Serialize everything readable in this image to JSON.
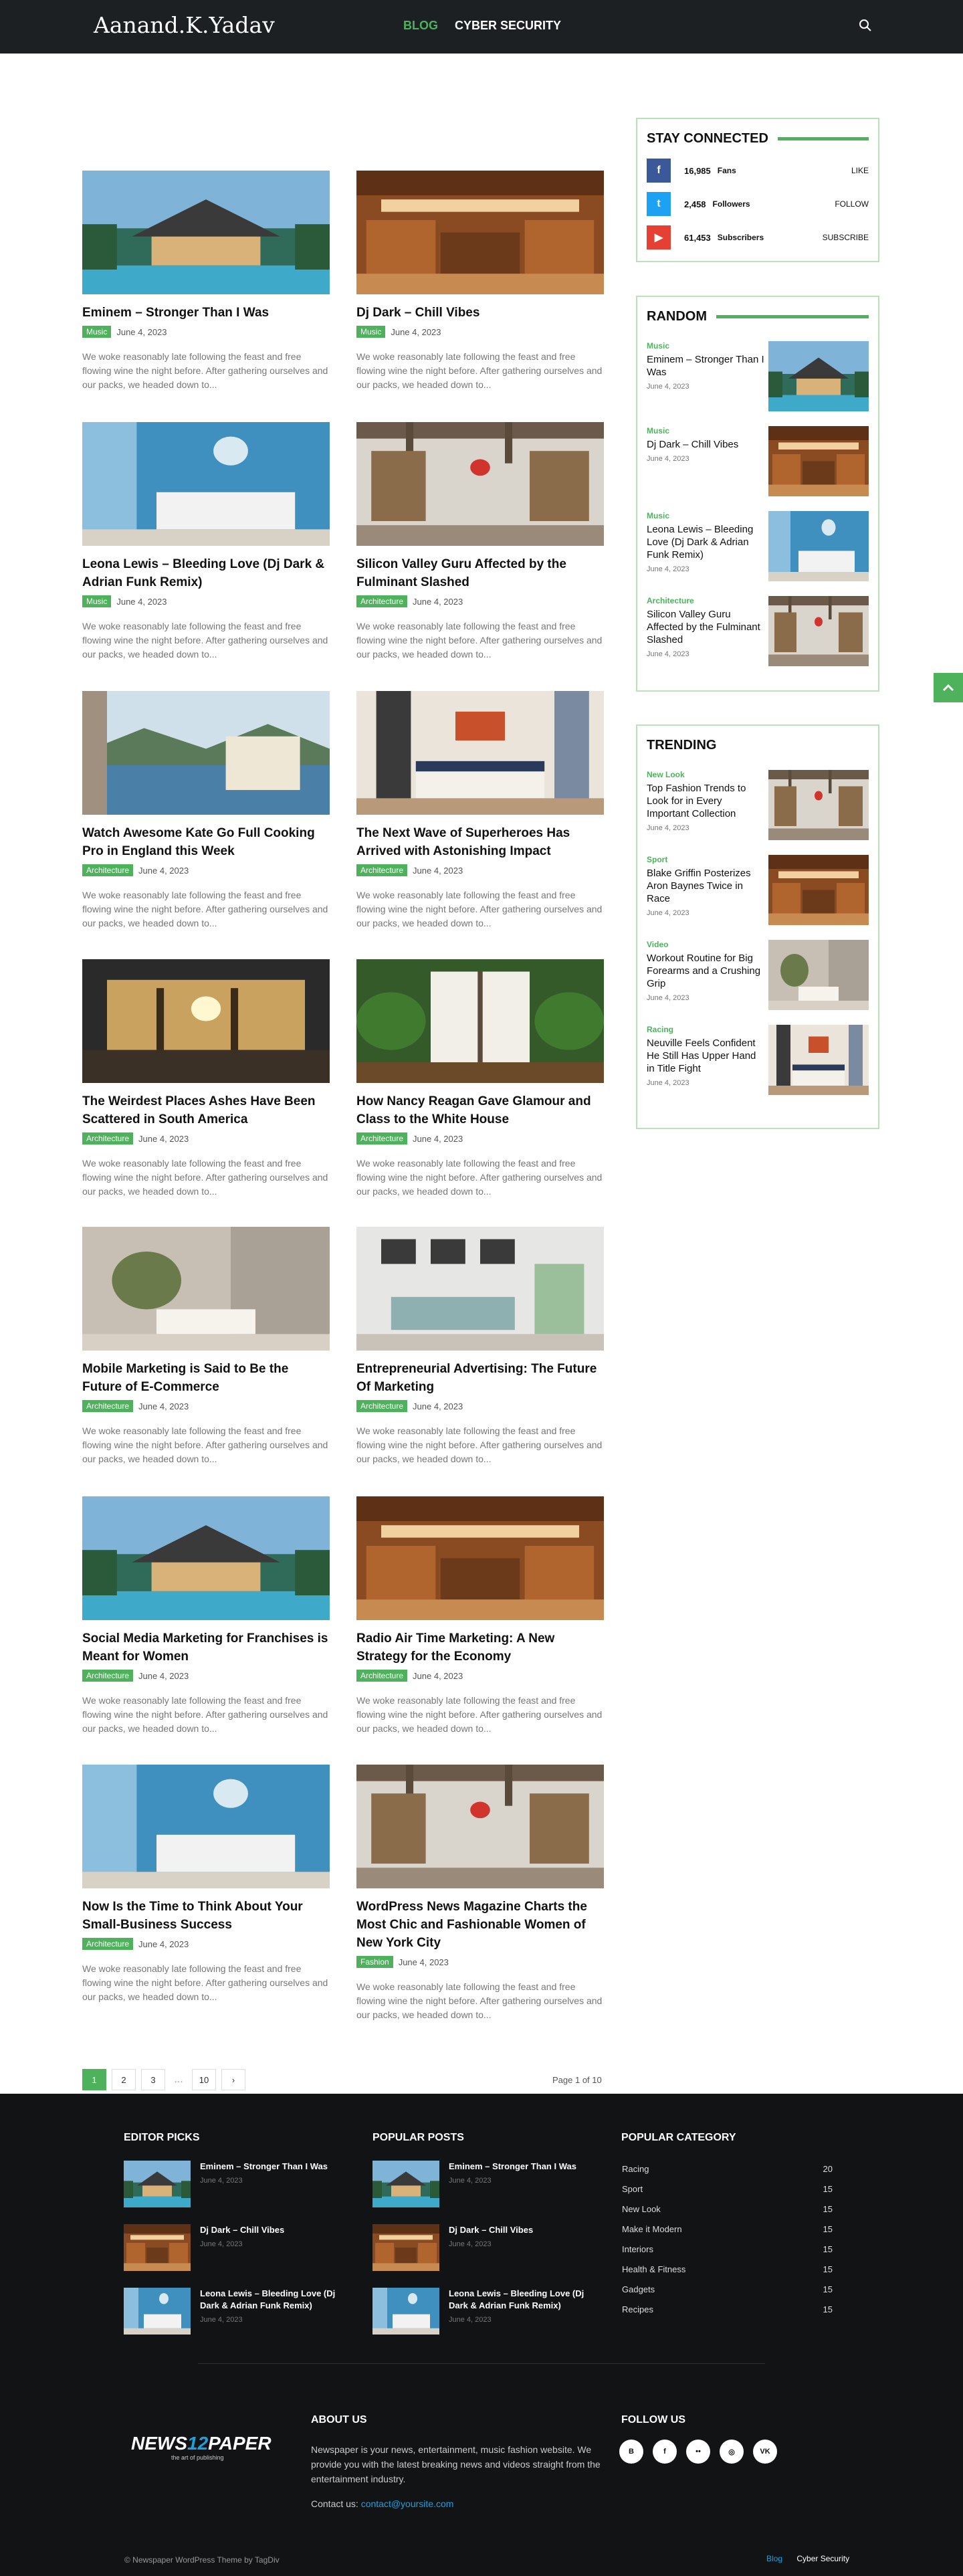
{
  "header": {
    "logo": "Aanand.K.Yadav",
    "nav": [
      "BLOG",
      "CYBER SECURITY"
    ],
    "search_icon": "search-icon"
  },
  "posts": [
    {
      "title": "Eminem – Stronger Than I Was",
      "category": "Music",
      "date": "June 4, 2023",
      "excerpt": "We woke reasonably late following the feast and free flowing wine the night before. After gathering ourselves and our packs, we headed down to...",
      "scene": "pool"
    },
    {
      "title": "Dj Dark – Chill Vibes",
      "category": "Music",
      "date": "June 4, 2023",
      "excerpt": "We woke reasonably late following the feast and free flowing wine the night before. After gathering ourselves and our packs, we headed down to...",
      "scene": "wood"
    },
    {
      "title": "Leona Lewis – Bleeding Love (Dj Dark & Adrian Funk Remix)",
      "category": "Music",
      "date": "June 4, 2023",
      "excerpt": "We woke reasonably late following the feast and free flowing wine the night before. After gathering ourselves and our packs, we headed down to...",
      "scene": "blue"
    },
    {
      "title": "Silicon Valley Guru Affected by the Fulminant Slashed",
      "category": "Architecture",
      "date": "June 4, 2023",
      "excerpt": "We woke reasonably late following the feast and free flowing wine the night before. After gathering ourselves and our packs, we headed down to...",
      "scene": "loft"
    },
    {
      "title": "Watch Awesome Kate Go Full Cooking Pro in England this Week",
      "category": "Architecture",
      "date": "June 4, 2023",
      "excerpt": "We woke reasonably late following the feast and free flowing wine the night before. After gathering ourselves and our packs, we headed down to...",
      "scene": "lake"
    },
    {
      "title": "The Next Wave of Superheroes Has Arrived with Astonishing Impact",
      "category": "Architecture",
      "date": "June 4, 2023",
      "excerpt": "We woke reasonably late following the feast and free flowing wine the night before. After gathering ourselves and our packs, we headed down to...",
      "scene": "bedroom"
    },
    {
      "title": "The Weirdest Places Ashes Have Been Scattered in South America",
      "category": "Architecture",
      "date": "June 4, 2023",
      "excerpt": "We woke reasonably late following the feast and free flowing wine the night before. After gathering ourselves and our packs, we headed down to...",
      "scene": "veranda"
    },
    {
      "title": "How Nancy Reagan Gave Glamour and Class to the White House",
      "category": "Architecture",
      "date": "June 4, 2023",
      "excerpt": "We woke reasonably late following the feast and free flowing wine the night before. After gathering ourselves and our packs, we headed down to...",
      "scene": "plants"
    },
    {
      "title": "Mobile Marketing is Said to Be the Future of E-Commerce",
      "category": "Architecture",
      "date": "June 4, 2023",
      "excerpt": "We woke reasonably late following the feast and free flowing wine the night before. After gathering ourselves and our packs, we headed down to...",
      "scene": "bath"
    },
    {
      "title": "Entrepreneurial Advertising: The Future Of Marketing",
      "category": "Architecture",
      "date": "June 4, 2023",
      "excerpt": "We woke reasonably late following the feast and free flowing wine the night before. After gathering ourselves and our packs, we headed down to...",
      "scene": "gallery"
    },
    {
      "title": "Social Media Marketing for Franchises is Meant for Women",
      "category": "Architecture",
      "date": "June 4, 2023",
      "excerpt": "We woke reasonably late following the feast and free flowing wine the night before. After gathering ourselves and our packs, we headed down to...",
      "scene": "pool"
    },
    {
      "title": "Radio Air Time Marketing: A New Strategy for the Economy",
      "category": "Architecture",
      "date": "June 4, 2023",
      "excerpt": "We woke reasonably late following the feast and free flowing wine the night before. After gathering ourselves and our packs, we headed down to...",
      "scene": "wood"
    },
    {
      "title": "Now Is the Time to Think About Your Small-Business Success",
      "category": "Architecture",
      "date": "June 4, 2023",
      "excerpt": "We woke reasonably late following the feast and free flowing wine the night before. After gathering ourselves and our packs, we headed down to...",
      "scene": "blue"
    },
    {
      "title": "WordPress News Magazine Charts the Most Chic and Fashionable Women of New York City",
      "category": "Fashion",
      "date": "June 4, 2023",
      "excerpt": "We woke reasonably late following the feast and free flowing wine the night before. After gathering ourselves and our packs, we headed down to...",
      "scene": "loft"
    }
  ],
  "stay_connected": {
    "title": "STAY CONNECTED",
    "rows": [
      {
        "icon": "f",
        "count": "16,985",
        "name": "Fans",
        "action": "LIKE",
        "color": "#3b5998"
      },
      {
        "icon": "t",
        "count": "2,458",
        "name": "Followers",
        "action": "FOLLOW",
        "color": "#1da1f2"
      },
      {
        "icon": "▶",
        "count": "61,453",
        "name": "Subscribers",
        "action": "SUBSCRIBE",
        "color": "#e44134"
      }
    ]
  },
  "random": {
    "title": "RANDOM",
    "items": [
      {
        "category": "Music",
        "title": "Eminem – Stronger Than I Was",
        "date": "June 4, 2023",
        "scene": "pool"
      },
      {
        "category": "Music",
        "title": "Dj Dark – Chill Vibes",
        "date": "June 4, 2023",
        "scene": "wood"
      },
      {
        "category": "Music",
        "title": "Leona Lewis – Bleeding Love (Dj Dark & Adrian Funk Remix)",
        "date": "June 4, 2023",
        "scene": "blue"
      },
      {
        "category": "Architecture",
        "title": "Silicon Valley Guru Affected by the Fulminant Slashed",
        "date": "June 4, 2023",
        "scene": "loft"
      }
    ]
  },
  "trending": {
    "title": "TRENDING",
    "items": [
      {
        "category": "New Look",
        "title": "Top Fashion Trends to Look for in Every Important Collection",
        "date": "June 4, 2023",
        "scene": "loft"
      },
      {
        "category": "Sport",
        "title": "Blake Griffin Posterizes Aron Baynes Twice in Race",
        "date": "June 4, 2023",
        "scene": "wood"
      },
      {
        "category": "Video",
        "title": "Workout Routine for Big Forearms and a Crushing Grip",
        "date": "June 4, 2023",
        "scene": "bath"
      },
      {
        "category": "Racing",
        "title": "Neuville Feels Confident He Still Has Upper Hand in Title Fight",
        "date": "June 4, 2023",
        "scene": "bedroom"
      }
    ]
  },
  "pagination": {
    "pages": [
      "1",
      "2",
      "3"
    ],
    "dots": "...",
    "last": "10",
    "next": "›",
    "info": "Page 1 of 10"
  },
  "footer": {
    "editor_picks": {
      "title": "EDITOR PICKS",
      "items": [
        {
          "title": "Eminem – Stronger Than I Was",
          "date": "June 4, 2023",
          "scene": "pool"
        },
        {
          "title": "Dj Dark – Chill Vibes",
          "date": "June 4, 2023",
          "scene": "wood"
        },
        {
          "title": "Leona Lewis – Bleeding Love (Dj Dark & Adrian Funk Remix)",
          "date": "June 4, 2023",
          "scene": "blue"
        }
      ]
    },
    "popular_posts": {
      "title": "POPULAR POSTS",
      "items": [
        {
          "title": "Eminem – Stronger Than I Was",
          "date": "June 4, 2023",
          "scene": "pool"
        },
        {
          "title": "Dj Dark – Chill Vibes",
          "date": "June 4, 2023",
          "scene": "wood"
        },
        {
          "title": "Leona Lewis – Bleeding Love (Dj Dark & Adrian Funk Remix)",
          "date": "June 4, 2023",
          "scene": "blue"
        }
      ]
    },
    "popular_category": {
      "title": "POPULAR CATEGORY",
      "items": [
        {
          "name": "Racing",
          "count": "20"
        },
        {
          "name": "Sport",
          "count": "15"
        },
        {
          "name": "New Look",
          "count": "15"
        },
        {
          "name": "Make it Modern",
          "count": "15"
        },
        {
          "name": "Interiors",
          "count": "15"
        },
        {
          "name": "Health & Fitness",
          "count": "15"
        },
        {
          "name": "Gadgets",
          "count": "15"
        },
        {
          "name": "Recipes",
          "count": "15"
        }
      ]
    },
    "logo_main": "NEWS",
    "logo_num": "12",
    "logo_tail": "PAPER",
    "logo_tag": "the art of publishing",
    "about_title": "ABOUT US",
    "about_text": "Newspaper is your news, entertainment, music fashion website. We provide you with the latest breaking news and videos straight from the entertainment industry.",
    "contact_label": "Contact us: ",
    "contact_email": "contact@yoursite.com",
    "follow_title": "FOLLOW US",
    "follow_icons": [
      "B",
      "f",
      "••",
      "◎",
      "VK"
    ],
    "copyright": "© Newspaper WordPress Theme by TagDiv",
    "links": [
      "Blog",
      "Cyber Security"
    ],
    "link_colors": [
      "#1aa1e0",
      "#ffffff"
    ]
  }
}
